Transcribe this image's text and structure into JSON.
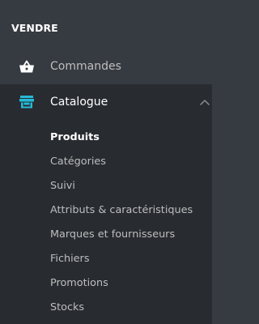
{
  "section": {
    "title": "VENDRE"
  },
  "nav": {
    "orders": {
      "label": "Commandes",
      "icon": "basket-icon"
    },
    "catalog": {
      "label": "Catalogue",
      "icon": "store-icon",
      "expanded": true,
      "icon_color": "#25b9d7"
    }
  },
  "submenu": {
    "items": [
      {
        "label": "Produits",
        "active": true
      },
      {
        "label": "Catégories"
      },
      {
        "label": "Suivi"
      },
      {
        "label": "Attributs & caractéristiques"
      },
      {
        "label": "Marques et fournisseurs"
      },
      {
        "label": "Fichiers"
      },
      {
        "label": "Promotions"
      },
      {
        "label": "Stocks"
      }
    ]
  },
  "colors": {
    "background": "#363a41",
    "active_background": "#282b30",
    "accent": "#25b9d7",
    "text": "#bebebe",
    "text_active": "#ffffff"
  }
}
